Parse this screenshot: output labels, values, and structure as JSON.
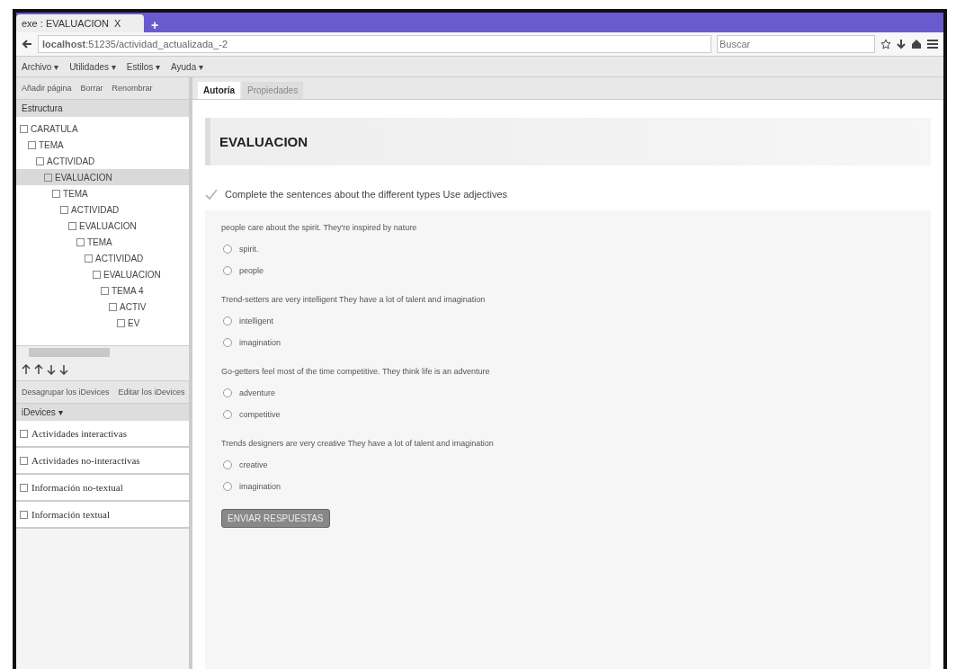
{
  "browser": {
    "tab_title": "exe : EVALUACION",
    "tab_close": "X",
    "new_tab": "+",
    "url_host": "localhost",
    "url_path": ":51235/actividad_actualizada_-2",
    "search": {
      "placeholder": "Buscar"
    }
  },
  "menu": [
    "Archivo ▾",
    "Utilidades ▾",
    "Estilos ▾",
    "Ayuda ▾"
  ],
  "sidebar": {
    "actions": [
      "Añadir página",
      "Borrar",
      "Renombrar"
    ],
    "structure_title": "Estructura",
    "tree": [
      {
        "label": "CARATULA",
        "selected": false,
        "children": [
          {
            "label": "TEMA",
            "selected": false,
            "children": [
              {
                "label": "ACTIVIDAD",
                "selected": false,
                "children": [
                  {
                    "label": "EVALUACION",
                    "selected": true,
                    "children": [
                      {
                        "label": "TEMA",
                        "selected": false,
                        "children": [
                          {
                            "label": "ACTIVIDAD",
                            "selected": false,
                            "children": [
                              {
                                "label": "EVALUACION",
                                "selected": false,
                                "children": [
                                  {
                                    "label": "TEMA",
                                    "selected": false,
                                    "children": [
                                      {
                                        "label": "ACTIVIDAD",
                                        "selected": false,
                                        "children": [
                                          {
                                            "label": "EVALUACION",
                                            "selected": false,
                                            "children": [
                                              {
                                                "label": "TEMA 4",
                                                "selected": false,
                                                "children": [
                                                  {
                                                    "label": "ACTIV",
                                                    "selected": false,
                                                    "children": [
                                                      {
                                                        "label": "EV",
                                                        "selected": false
                                                      }
                                                    ]
                                                  }
                                                ]
                                              }
                                            ]
                                          }
                                        ]
                                      }
                                    ]
                                  }
                                ]
                              }
                            ]
                          }
                        ]
                      }
                    ]
                  }
                ]
              }
            ]
          }
        ]
      }
    ],
    "idevice_actions": [
      "Desagrupar los iDevices",
      "Editar los iDevices"
    ],
    "idevices_title": "iDevices ▾",
    "categories": [
      "Actividades interactivas",
      "Actividades no-interactivas",
      "Información no-textual",
      "Información textual"
    ]
  },
  "content": {
    "tabs": [
      {
        "label": "Autoría",
        "selected": true
      },
      {
        "label": "Propiedades",
        "selected": false
      }
    ],
    "page_title": "EVALUACION",
    "instruction": "Complete the sentences about the different types Use adjectives",
    "questions": [
      {
        "text": "people care about the spirit. They're inspired by nature",
        "options": [
          {
            "label": "spirit.",
            "selected": false
          },
          {
            "label": "people",
            "selected": false
          }
        ]
      },
      {
        "text": "Trend-setters are very intelligent They have a lot of talent and imagination",
        "options": [
          {
            "label": "intelligent",
            "selected": false
          },
          {
            "label": "imagination",
            "selected": false
          }
        ]
      },
      {
        "text": "Go-getters feel most of the time competitive. They think life is an adventure",
        "options": [
          {
            "label": "adventure",
            "selected": false
          },
          {
            "label": "competitive",
            "selected": false
          }
        ]
      },
      {
        "text": "Trends designers are very creative They have a lot of talent and imagination",
        "options": [
          {
            "label": "creative",
            "selected": false
          },
          {
            "label": "imagination",
            "selected": false
          }
        ]
      }
    ],
    "submit": "ENVIAR RESPUESTAS"
  }
}
